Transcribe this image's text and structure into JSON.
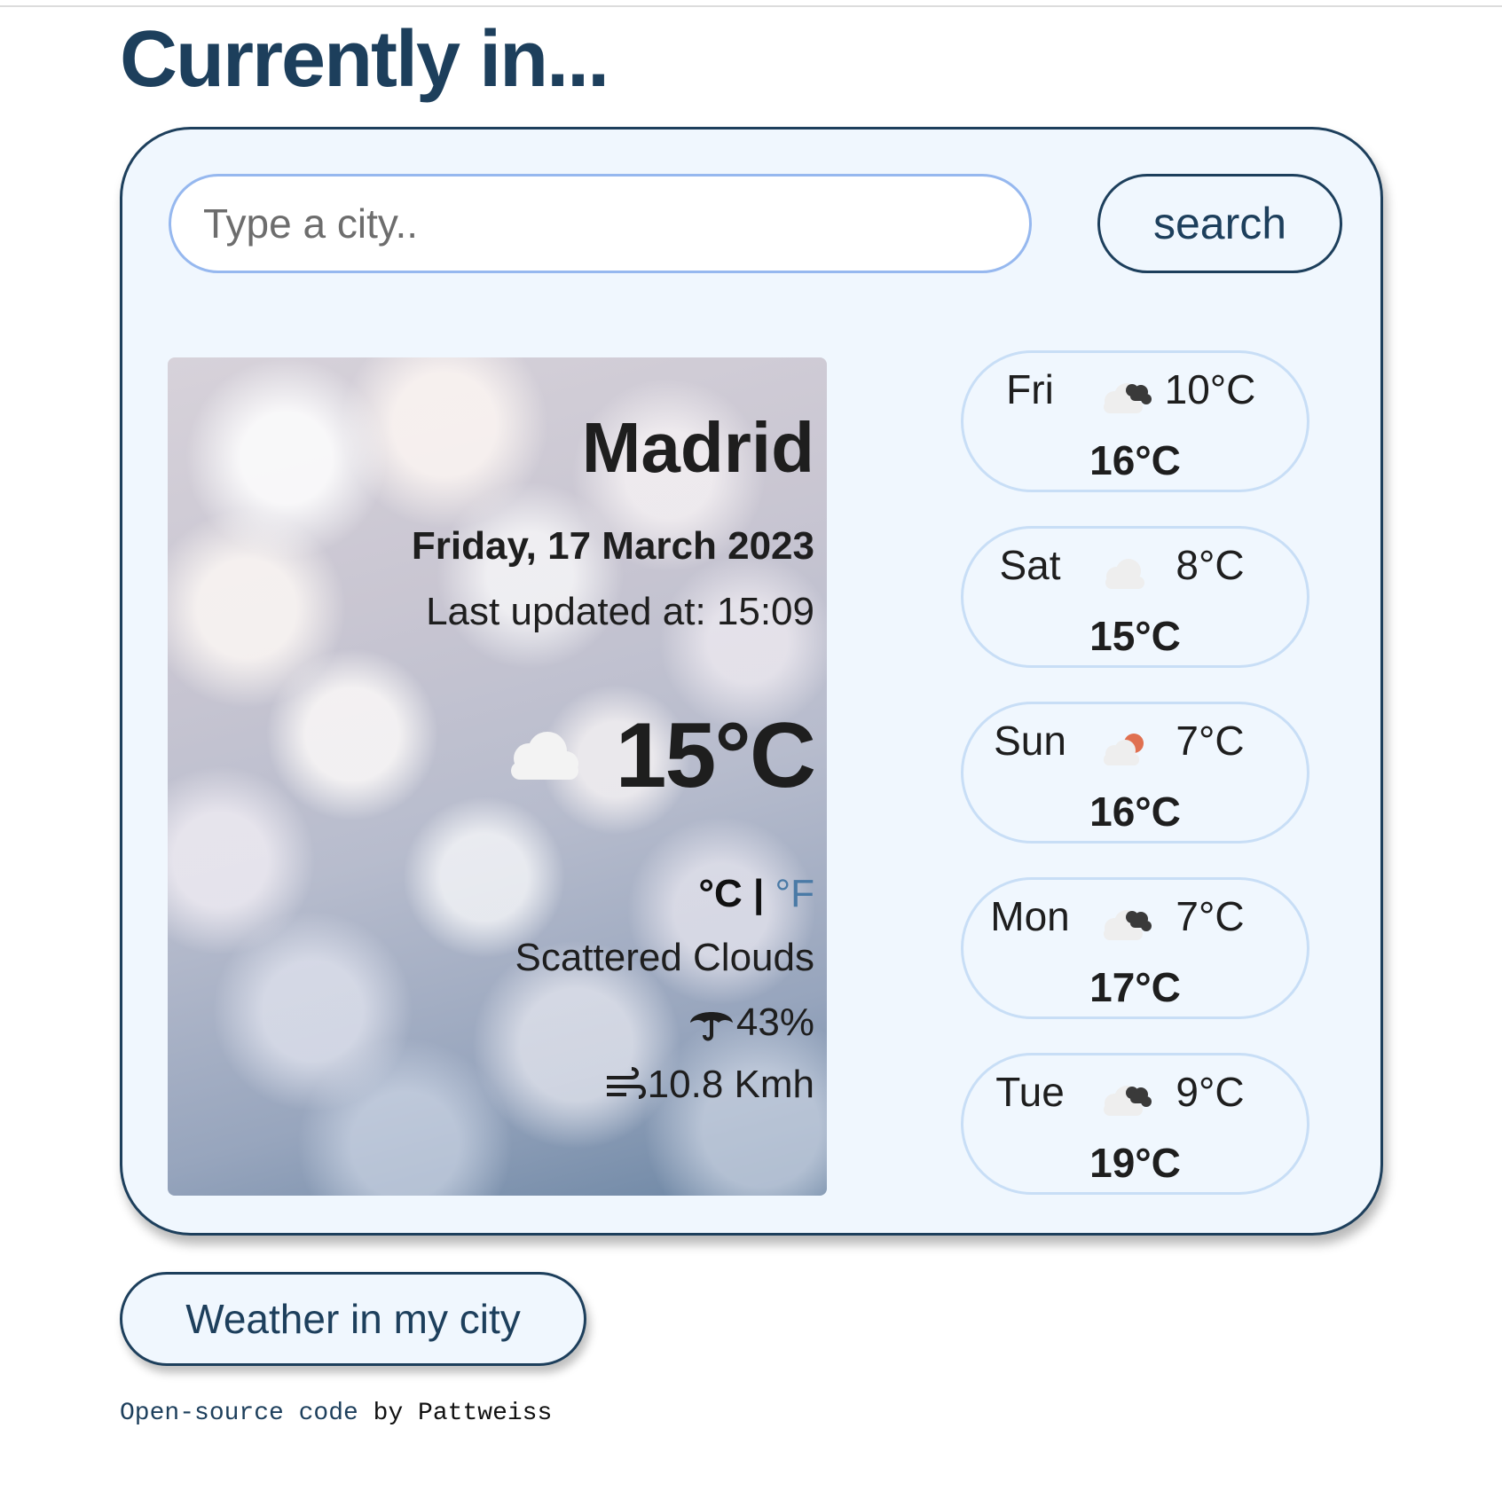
{
  "header": {
    "title": "Currently in..."
  },
  "search": {
    "placeholder": "Type a city..",
    "button_label": "search"
  },
  "current": {
    "city": "Madrid",
    "date": "Friday, 17 March 2023",
    "updated": "Last updated at: 15:09",
    "icon": "cloud-icon",
    "temperature": "15°C",
    "unit_celsius": "°C",
    "unit_separator": "|",
    "unit_fahrenheit": "°F",
    "description": "Scattered Clouds",
    "humidity": "43%",
    "wind": "10.8 Kmh"
  },
  "forecast": [
    {
      "day": "Fri",
      "low": "10°C",
      "high": "16°C",
      "icon": "broken-clouds-icon"
    },
    {
      "day": "Sat",
      "low": "8°C",
      "high": "15°C",
      "icon": "few-clouds-icon"
    },
    {
      "day": "Sun",
      "low": "7°C",
      "high": "16°C",
      "icon": "partly-cloudy-icon"
    },
    {
      "day": "Mon",
      "low": "7°C",
      "high": "17°C",
      "icon": "broken-clouds-icon"
    },
    {
      "day": "Tue",
      "low": "9°C",
      "high": "19°C",
      "icon": "broken-clouds-icon"
    }
  ],
  "my_city_button": "Weather in my city",
  "footer": {
    "link_text": "Open-source code",
    "rest": " by Pattweiss"
  },
  "colors": {
    "primary": "#1d3f5c",
    "panel_bg": "#f0f7fe",
    "input_border": "#96b8ef",
    "card_border": "#c8def6",
    "fahrenheit_link": "#4a7aa6"
  }
}
